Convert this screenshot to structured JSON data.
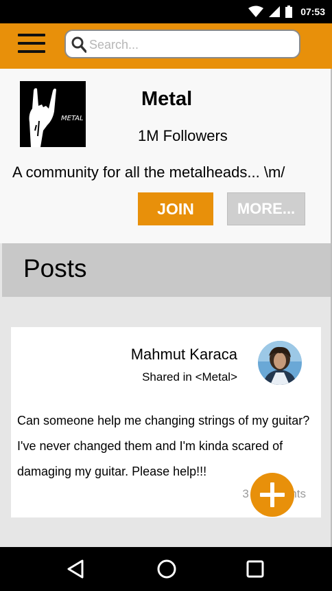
{
  "status_bar": {
    "time": "07:53"
  },
  "search": {
    "placeholder": "Search..."
  },
  "community": {
    "logo_text": "METAL",
    "name": "Metal",
    "followers": "1M Followers",
    "description": "A community for all the metalheads... \\m/",
    "join_label": "JOIN",
    "more_label": "MORE..."
  },
  "posts": {
    "title": "Posts",
    "items": [
      {
        "author": "Mahmut Karaca",
        "shared_in": "Shared in <Metal>",
        "body_lines": [
          "Can someone help me changing strings of my guitar?",
          "I've never changed them and I'm kinda scared of",
          "damaging my guitar. Please help!!!"
        ],
        "comments": "3 comments"
      }
    ]
  },
  "colors": {
    "accent": "#e8900a",
    "posts_header": "#c8c8c8",
    "disabled_button": "#cfcfcf"
  },
  "icons": [
    "wifi-icon",
    "signal-icon",
    "battery-icon",
    "menu-icon",
    "search-icon",
    "add-icon",
    "back-icon",
    "home-icon",
    "recents-icon"
  ]
}
